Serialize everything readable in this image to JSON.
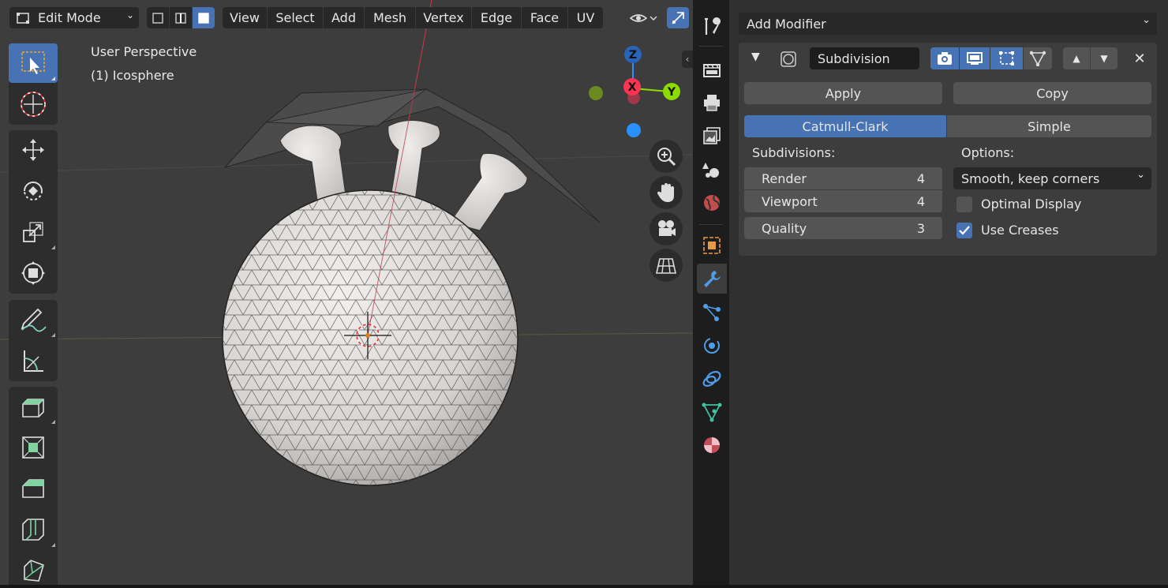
{
  "viewport": {
    "header": {
      "mode_label": "Edit Mode",
      "menus": [
        "View",
        "Select",
        "Add",
        "Mesh",
        "Vertex",
        "Edge",
        "Face",
        "UV"
      ]
    },
    "overlay": {
      "perspective": "User Perspective",
      "object": "(1) Icosphere"
    },
    "gizmo": {
      "x": "X",
      "y": "Y",
      "z": "Z"
    }
  },
  "properties": {
    "add_modifier": "Add Modifier",
    "modifier": {
      "name": "Subdivision",
      "apply_label": "Apply",
      "copy_label": "Copy",
      "algorithms": [
        "Catmull-Clark",
        "Simple"
      ],
      "active_algorithm": "Catmull-Clark",
      "subdivisions_label": "Subdivisions:",
      "render_label": "Render",
      "render_value": "4",
      "viewport_label": "Viewport",
      "viewport_value": "4",
      "quality_label": "Quality",
      "quality_value": "3",
      "options_label": "Options:",
      "uv_smooth": "Smooth, keep corners",
      "optimal_display_label": "Optimal Display",
      "optimal_display": false,
      "use_creases_label": "Use Creases",
      "use_creases": true
    }
  },
  "colors": {
    "accent": "#4772b3",
    "axis_x": "#ff3352",
    "axis_y": "#8bdc00",
    "axis_z": "#2890ff"
  }
}
